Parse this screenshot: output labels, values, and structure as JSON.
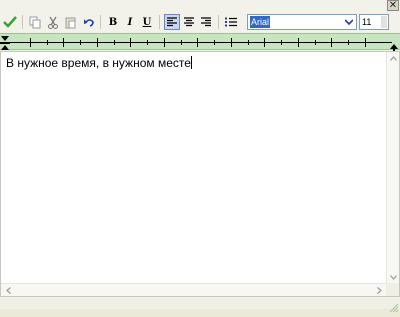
{
  "window": {
    "close_label": "✕"
  },
  "toolbar": {
    "bold_label": "B",
    "italic_label": "I",
    "underline_label": "U",
    "font_name": "Arial",
    "font_size": "11"
  },
  "editor": {
    "text": "В нужное время, в нужном месте"
  },
  "colors": {
    "ruler": "#c7e3c1",
    "accent": "#316ac5",
    "check": "#3aa336"
  }
}
